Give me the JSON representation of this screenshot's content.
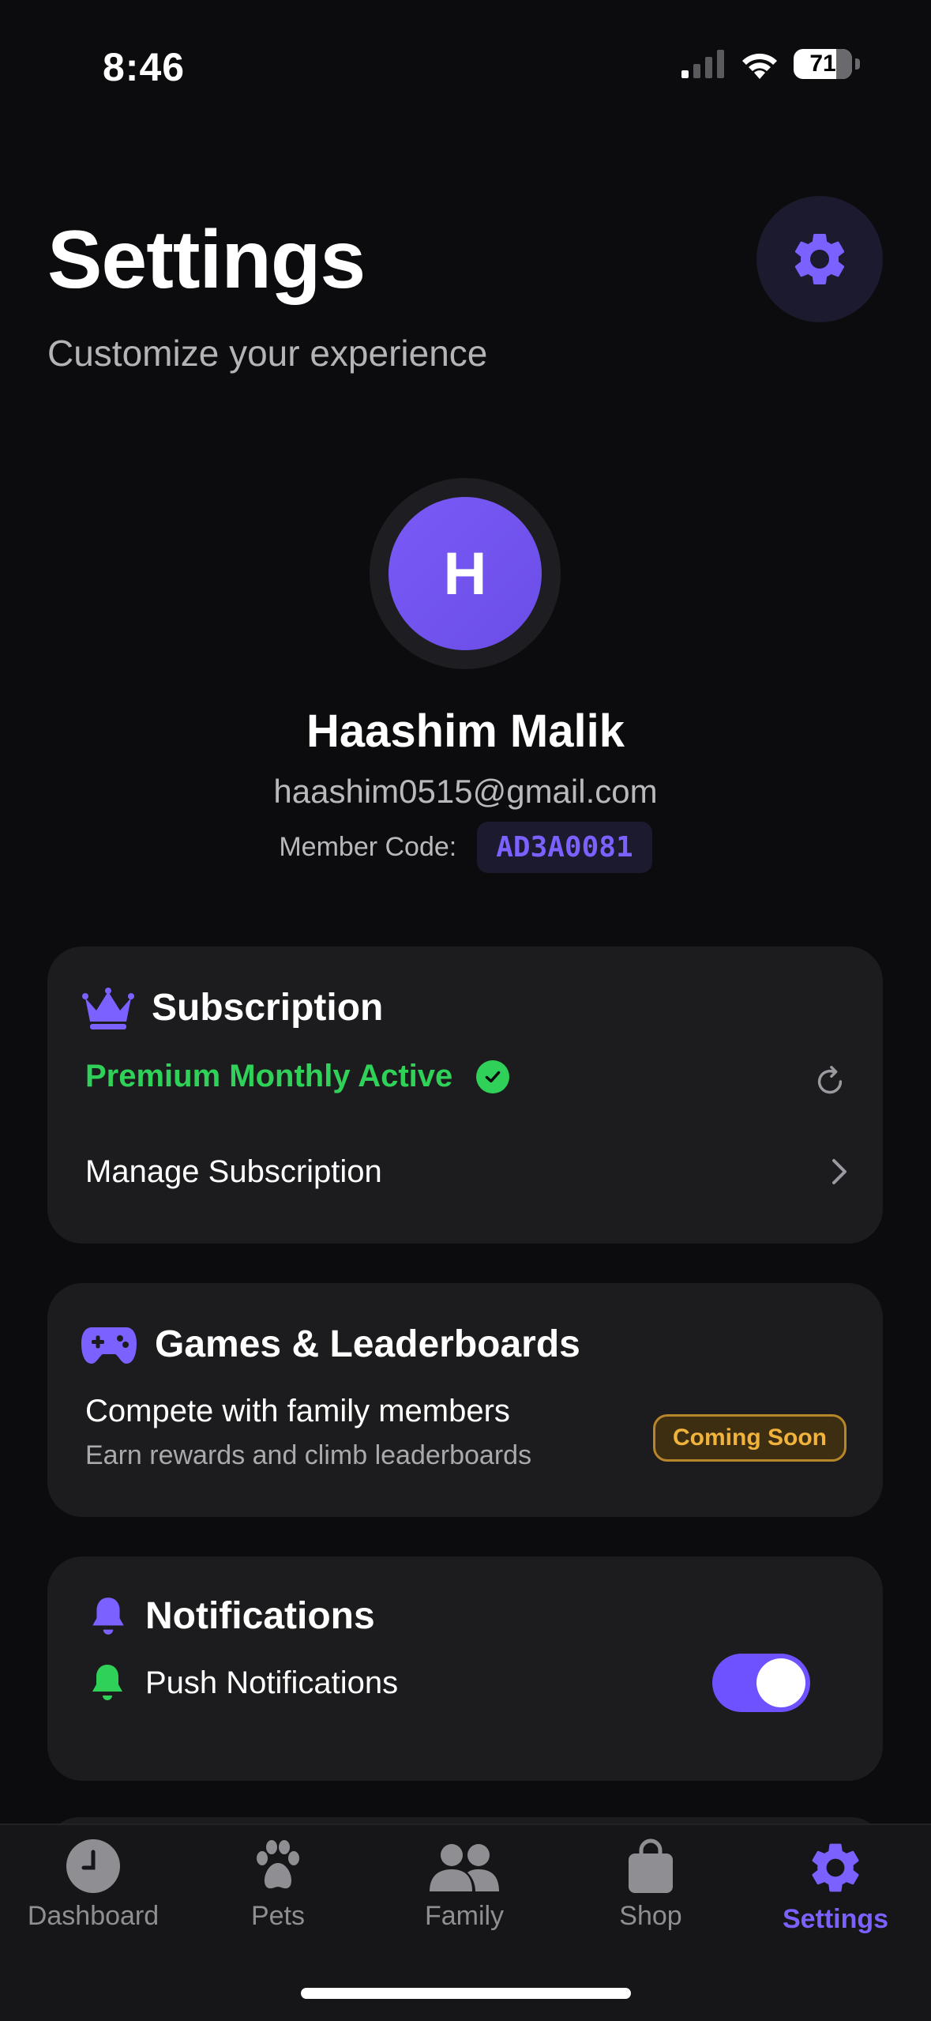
{
  "status_bar": {
    "time": "8:46",
    "battery": "71"
  },
  "header": {
    "title": "Settings",
    "subtitle": "Customize your experience"
  },
  "profile": {
    "initial": "H",
    "name": "Haashim Malik",
    "email": "haashim0515@gmail.com",
    "member_code_label": "Member Code:",
    "member_code": "AD3A0081"
  },
  "subscription": {
    "title": "Subscription",
    "status": "Premium Monthly Active",
    "manage_label": "Manage Subscription"
  },
  "games": {
    "title": "Games & Leaderboards",
    "line1": "Compete with family members",
    "line2": "Earn rewards and climb leaderboards",
    "badge": "Coming Soon"
  },
  "notifications": {
    "title": "Notifications",
    "push_label": "Push Notifications",
    "push_enabled": true
  },
  "tabbar": {
    "items": [
      {
        "label": "Dashboard",
        "icon": "clock-icon"
      },
      {
        "label": "Pets",
        "icon": "paw-icon"
      },
      {
        "label": "Family",
        "icon": "people-icon"
      },
      {
        "label": "Shop",
        "icon": "bag-icon"
      },
      {
        "label": "Settings",
        "icon": "gear-icon",
        "active": true
      }
    ]
  },
  "colors": {
    "accent": "#7b61ff",
    "success": "#30d158",
    "warning": "#f2b33d",
    "background": "#0c0c0e",
    "card": "#1c1c1e"
  }
}
